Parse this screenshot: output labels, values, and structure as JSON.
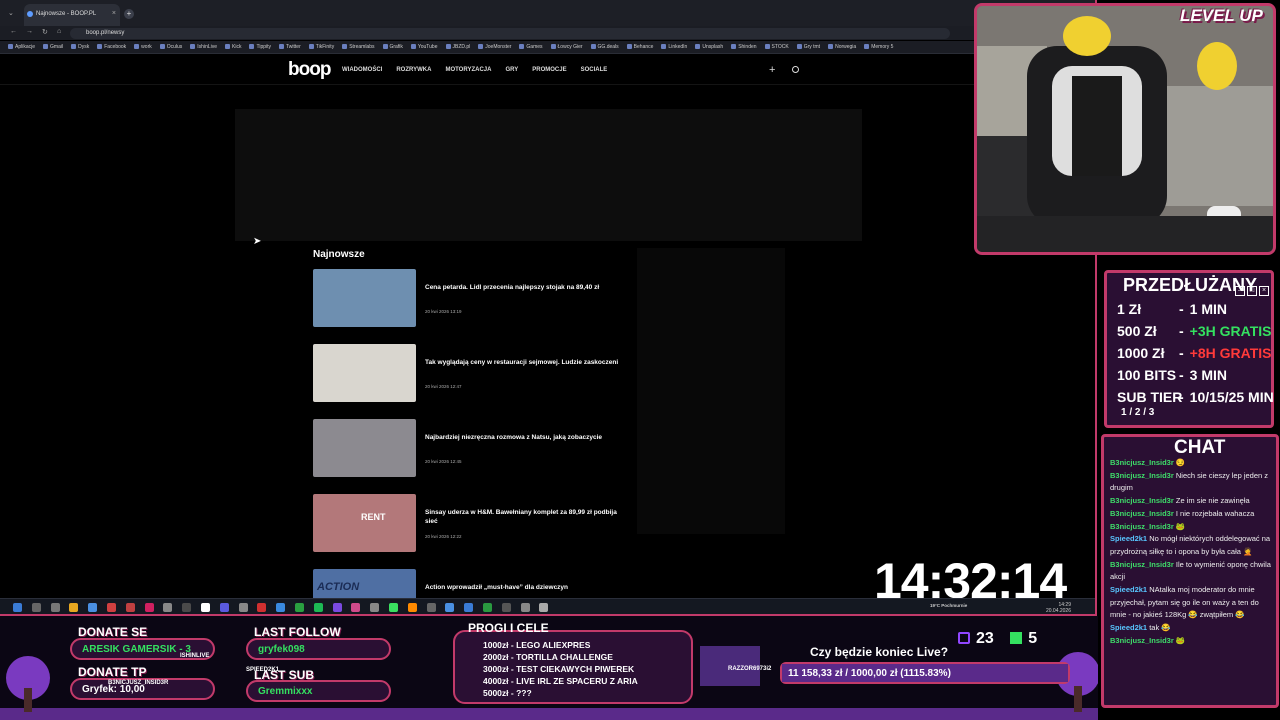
{
  "browser": {
    "tab_title": "Najnowsze - BOOP.PL",
    "tab_close": "×",
    "new_tab": "+",
    "url": "boop.pl/newsy",
    "bookmarks": [
      "Aplikacje",
      "Gmail",
      "Dysk",
      "Facebook",
      "work",
      "Oculus",
      "IshinLive",
      "Kick",
      "Tippity",
      "Twitter",
      "TikFinity",
      "Streamlabs",
      "Grafik",
      "YouTube",
      "JBZD.pl",
      "JoeMonster",
      "Games",
      "Łowcy Gier",
      "GG.deals",
      "Behance",
      "LinkedIn",
      "Unsplash",
      "Shinden",
      "STOCK",
      "Gry tmt",
      "Norwegia",
      "Memory 5"
    ]
  },
  "site": {
    "logo": "boop",
    "nav": [
      "WIADOMOŚCI",
      "ROZRYWKA",
      "MOTORYZACJA",
      "GRY",
      "PROMOCJE",
      "SOCIALE"
    ],
    "plus_icon": "+",
    "section_title": "Najnowsze",
    "articles": [
      {
        "title": "Cena petarda. Lidl przecenia najlepszy stojak na 89,40 zł",
        "date": "20 kwi 2026 13:19",
        "thumb_color": "#6e8fb0"
      },
      {
        "title": "Tak wyglądają ceny w restauracji sejmowej. Ludzie zaskoczeni",
        "date": "20 kwi 2026 12:47",
        "thumb_color": "#d9d6cf"
      },
      {
        "title": "Najbardziej niezręczna rozmowa z Natsu, jaką zobaczycie",
        "date": "20 kwi 2026 12:45",
        "thumb_color": "#8c8a90"
      },
      {
        "title": "Sinsay uderza w H&M. Bawełniany komplet za 89,99 zł podbija sieć",
        "date": "20 kwi 2026 12:22",
        "thumb_color": "#b3787a"
      },
      {
        "title": "Action wprowadził „must-have” dla dziewczyn",
        "date": "",
        "thumb_color": "#4f6fa3"
      }
    ],
    "thumb_text_action": "ACTION",
    "thumb_text_rent": "RENT"
  },
  "taskbar": {
    "tray_line1": "14:29",
    "tray_line2": "20.04.2026",
    "weather": "19°C Pochmurnie"
  },
  "stream": {
    "clock": "14:32:14",
    "level_up": "LEVEL UP",
    "price_title": "PRZEDŁUŻANY",
    "price_rows": [
      {
        "amount": "1 Zł",
        "sep": "-",
        "value": "1 MIN",
        "color": "white"
      },
      {
        "amount": "500 Zł",
        "sep": "-",
        "value": "+3H GRATIS",
        "color": "green"
      },
      {
        "amount": "1000 Zł",
        "sep": "-",
        "value": "+8H GRATIS",
        "color": "red"
      },
      {
        "amount": "100 BITS",
        "sep": "-",
        "value": "3 MIN",
        "color": "white"
      },
      {
        "amount": "SUB TIER",
        "sep": "-",
        "value": "10/15/25 MIN",
        "color": "white"
      }
    ],
    "sub_tier_sub": "1 / 2 / 3",
    "chat_title": "CHAT",
    "chat": [
      {
        "user": "B3nicjusz_Insid3r",
        "msg": "😏",
        "user_class": "cn"
      },
      {
        "user": "B3nicjusz_Insid3r",
        "msg": "Niech sie cieszy lep jeden z drugim",
        "user_class": "cn"
      },
      {
        "user": "B3nicjusz_Insid3r",
        "msg": "Ze im sie nie zawinęła",
        "user_class": "cn"
      },
      {
        "user": "B3nicjusz_Insid3r",
        "msg": "I nie rozjebała wahacza",
        "user_class": "cn"
      },
      {
        "user": "B3nicjusz_Insid3r",
        "msg": "🐸",
        "user_class": "cn"
      },
      {
        "user": "Spieed2k1",
        "msg": "No mógł niektórych oddelegować na przydrożną siłkę to i opona by była cała 🤦",
        "user_class": "cs"
      },
      {
        "user": "B3nicjusz_Insid3r",
        "msg": "Ile to wymienić oponę chwila akcji",
        "user_class": "cn"
      },
      {
        "user": "Spieed2k1",
        "msg": "NAtalka moj moderator do mnie przyjechał, pytam się go ile on waży a ten do mnie - no jakieś 128Kg 😂 zwątpiłem 😂",
        "user_class": "cs"
      },
      {
        "user": "Spieed2k1",
        "msg": "tak 😂",
        "user_class": "cs"
      },
      {
        "user": "B3nicjusz_Insid3r",
        "msg": "🐸",
        "user_class": "cn"
      }
    ],
    "donate_se_label": "DONATE SE",
    "donate_se_value": "ARESIK GAMERSIK - 3",
    "donate_tp_label": "DONATE TP",
    "donate_tp_value": "Gryfek: 10,00",
    "last_follow_label": "LAST FOLLOW",
    "last_follow_value": "gryfek098",
    "last_sub_label": "LAST SUB",
    "last_sub_value": "Gremmixxx",
    "goals_title": "PROGI I CELE",
    "goals": [
      "1000zł - LEGO ALIEXPRES",
      "2000zł - TORTILLA CHALLENGE",
      "3000zł - TEST CIEKAWYCH PIWEREK",
      "4000zł - LIVE IRL ZE SPACERU Z ARIA",
      "5000zł - ???"
    ],
    "question": "Czy będzie koniec Live?",
    "progress_text": "11 158,33 zł / 1000,00 zł (1115.83%)",
    "progress_fraction": 1.0,
    "viewers": "23",
    "kick_count": "5",
    "overlay_name1": "ISHINLIVE",
    "overlay_name2": "B3NICJUSZ_INSID3R",
    "overlay_name3": "SPIEED2K1",
    "overlay_name4": "RAZZOR6973i2"
  }
}
